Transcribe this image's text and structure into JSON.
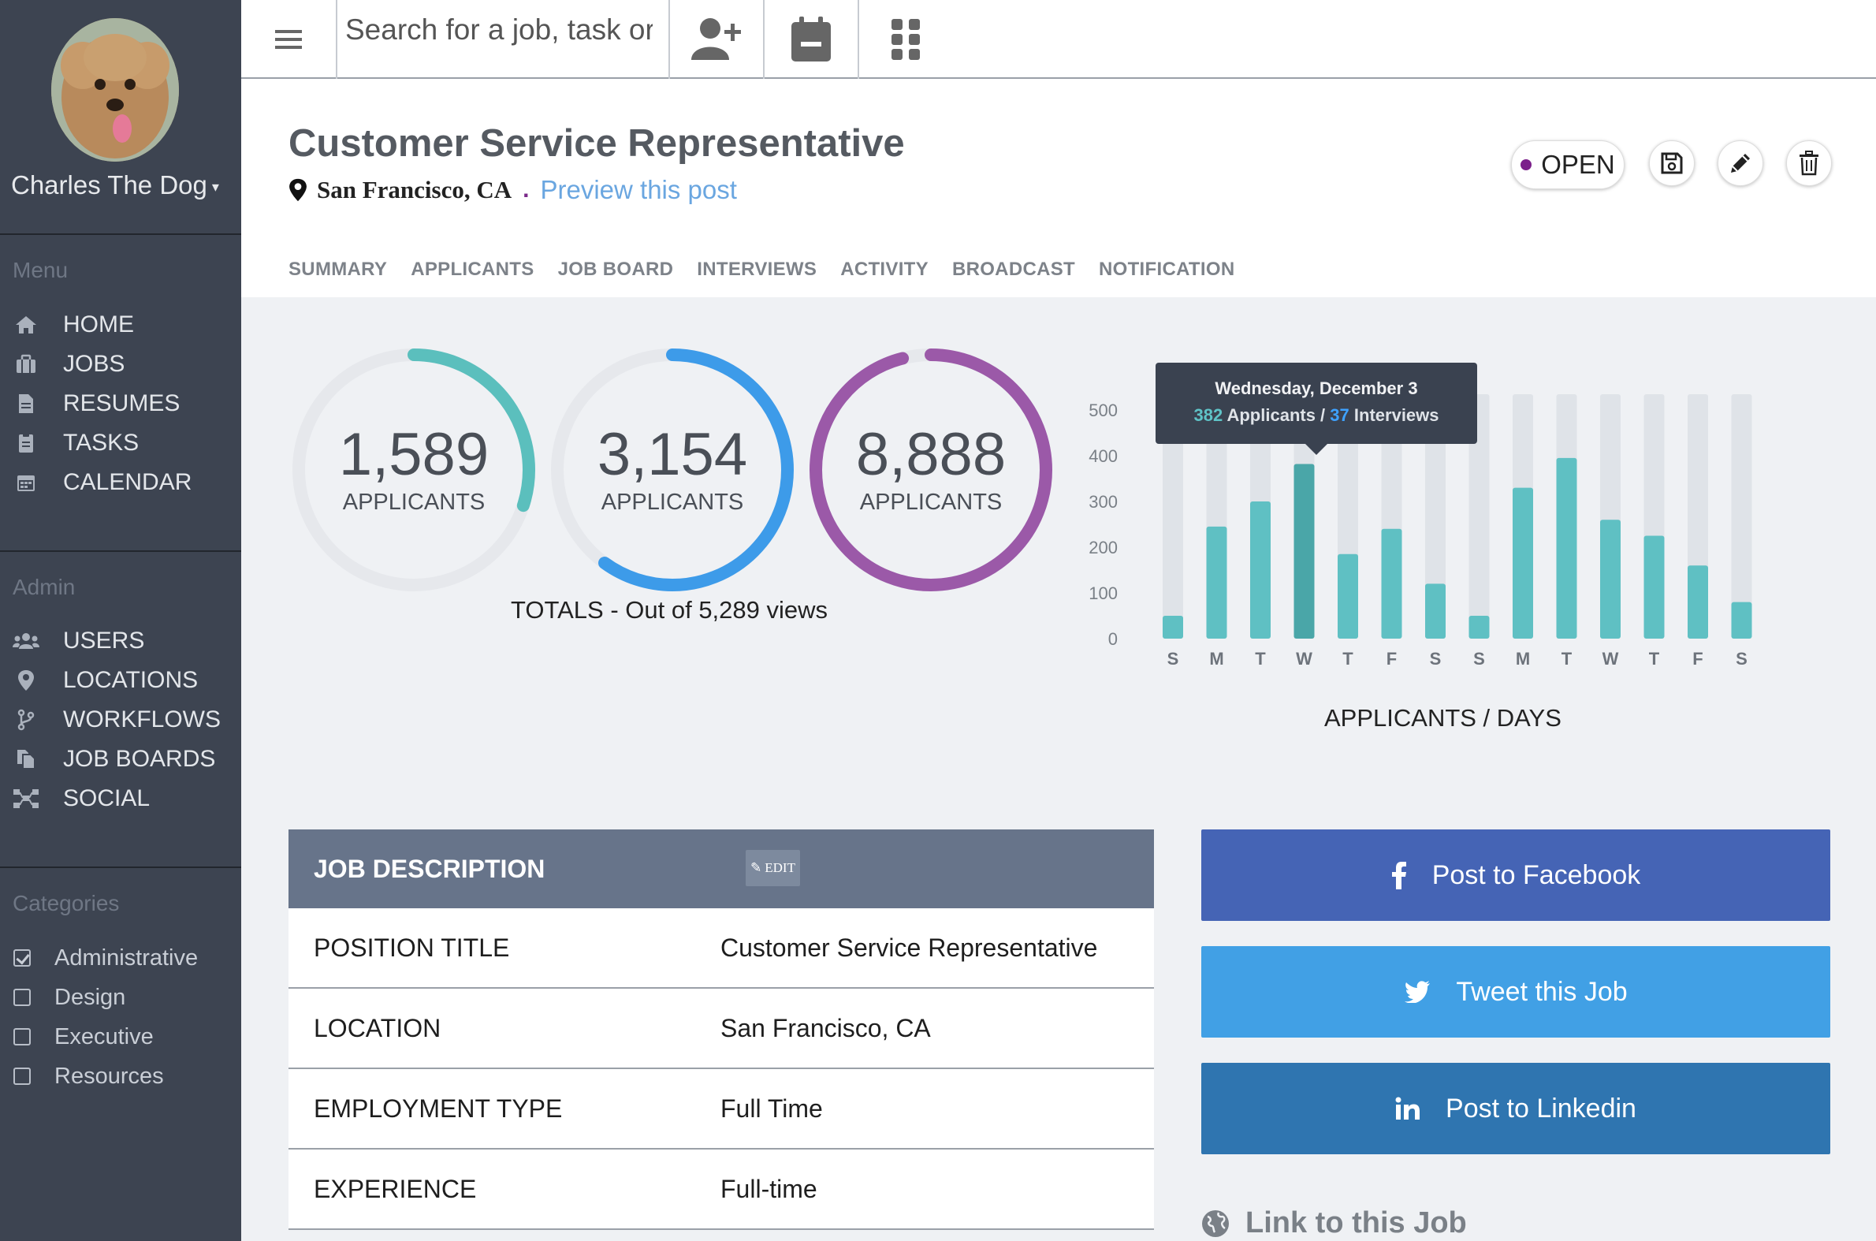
{
  "sidebar": {
    "profile_name": "Charles The Dog",
    "menu_title": "Menu",
    "menu_items": [
      {
        "label": "HOME",
        "icon": "home-icon"
      },
      {
        "label": "JOBS",
        "icon": "briefcase-icon"
      },
      {
        "label": "RESUMES",
        "icon": "file-icon"
      },
      {
        "label": "TASKS",
        "icon": "clipboard-icon"
      },
      {
        "label": "CALENDAR",
        "icon": "calendar-icon"
      }
    ],
    "admin_title": "Admin",
    "admin_items": [
      {
        "label": "USERS",
        "icon": "users-icon"
      },
      {
        "label": "LOCATIONS",
        "icon": "map-marker-icon"
      },
      {
        "label": "WORKFLOWS",
        "icon": "branch-icon"
      },
      {
        "label": "JOB BOARDS",
        "icon": "copy-icon"
      },
      {
        "label": "SOCIAL",
        "icon": "network-icon"
      }
    ],
    "categories_title": "Categories",
    "categories": [
      {
        "label": "Administrative",
        "checked": true
      },
      {
        "label": "Design",
        "checked": false
      },
      {
        "label": "Executive",
        "checked": false
      },
      {
        "label": "Resources",
        "checked": false
      }
    ]
  },
  "topbar": {
    "search_placeholder": "Search for a job, task or resume",
    "icons": [
      "menu-icon",
      "add-user-icon",
      "calendar-minus-icon",
      "apps-grid-icon"
    ]
  },
  "job": {
    "title": "Customer Service Representative",
    "location": "San Francisco, CA",
    "preview_link": "Preview this post",
    "status": "OPEN",
    "status_color": "#7b1f8a",
    "actions": [
      "save-icon",
      "edit-icon",
      "trash-icon"
    ]
  },
  "tabs": [
    "SUMMARY",
    "APPLICANTS",
    "JOB BOARD",
    "INTERVIEWS",
    "ACTIVITY",
    "BROADCAST",
    "NOTIFICATION"
  ],
  "stats": {
    "donuts": [
      {
        "value": "1,589",
        "label": "APPLICANTS",
        "fraction": 0.3,
        "color": "#5bbfbd"
      },
      {
        "value": "3,154",
        "label": "APPLICANTS",
        "fraction": 0.6,
        "color": "#3d9be9"
      },
      {
        "value": "8,888",
        "label": "APPLICANTS",
        "fraction": 0.96,
        "color": "#9b59a8"
      }
    ],
    "totals_text": "TOTALS - Out of 5,289 views"
  },
  "chart_data": {
    "type": "bar",
    "categories": [
      "S",
      "M",
      "T",
      "W",
      "T",
      "F",
      "S",
      "S",
      "M",
      "T",
      "W",
      "T",
      "F",
      "S"
    ],
    "values": [
      50,
      245,
      300,
      382,
      185,
      240,
      120,
      50,
      330,
      395,
      260,
      225,
      160,
      80
    ],
    "ylim": [
      0,
      500
    ],
    "yticks": [
      0,
      100,
      200,
      300,
      400,
      500
    ],
    "highlight_index": 3,
    "xlabel": "APPLICANTS / DAYS",
    "tooltip": {
      "date": "Wednesday, December 3",
      "applicants": "382",
      "applicants_label": "Applicants /",
      "interviews": "37",
      "interviews_label": "Interviews"
    }
  },
  "job_description": {
    "title": "JOB DESCRIPTION",
    "edit_label": "EDIT",
    "rows": [
      {
        "key": "POSITION TITLE",
        "value": "Customer Service Representative"
      },
      {
        "key": "LOCATION",
        "value": "San Francisco, CA"
      },
      {
        "key": "EMPLOYMENT TYPE",
        "value": "Full Time"
      },
      {
        "key": "EXPERIENCE",
        "value": "Full-time"
      }
    ]
  },
  "social": {
    "facebook": {
      "label": "Post to Facebook",
      "color": "#4564b5"
    },
    "twitter": {
      "label": "Tweet this Job",
      "color": "#41a0e5"
    },
    "linkedin": {
      "label": "Post to Linkedin",
      "color": "#2f75b0"
    },
    "link_title": "Link to this Job"
  }
}
